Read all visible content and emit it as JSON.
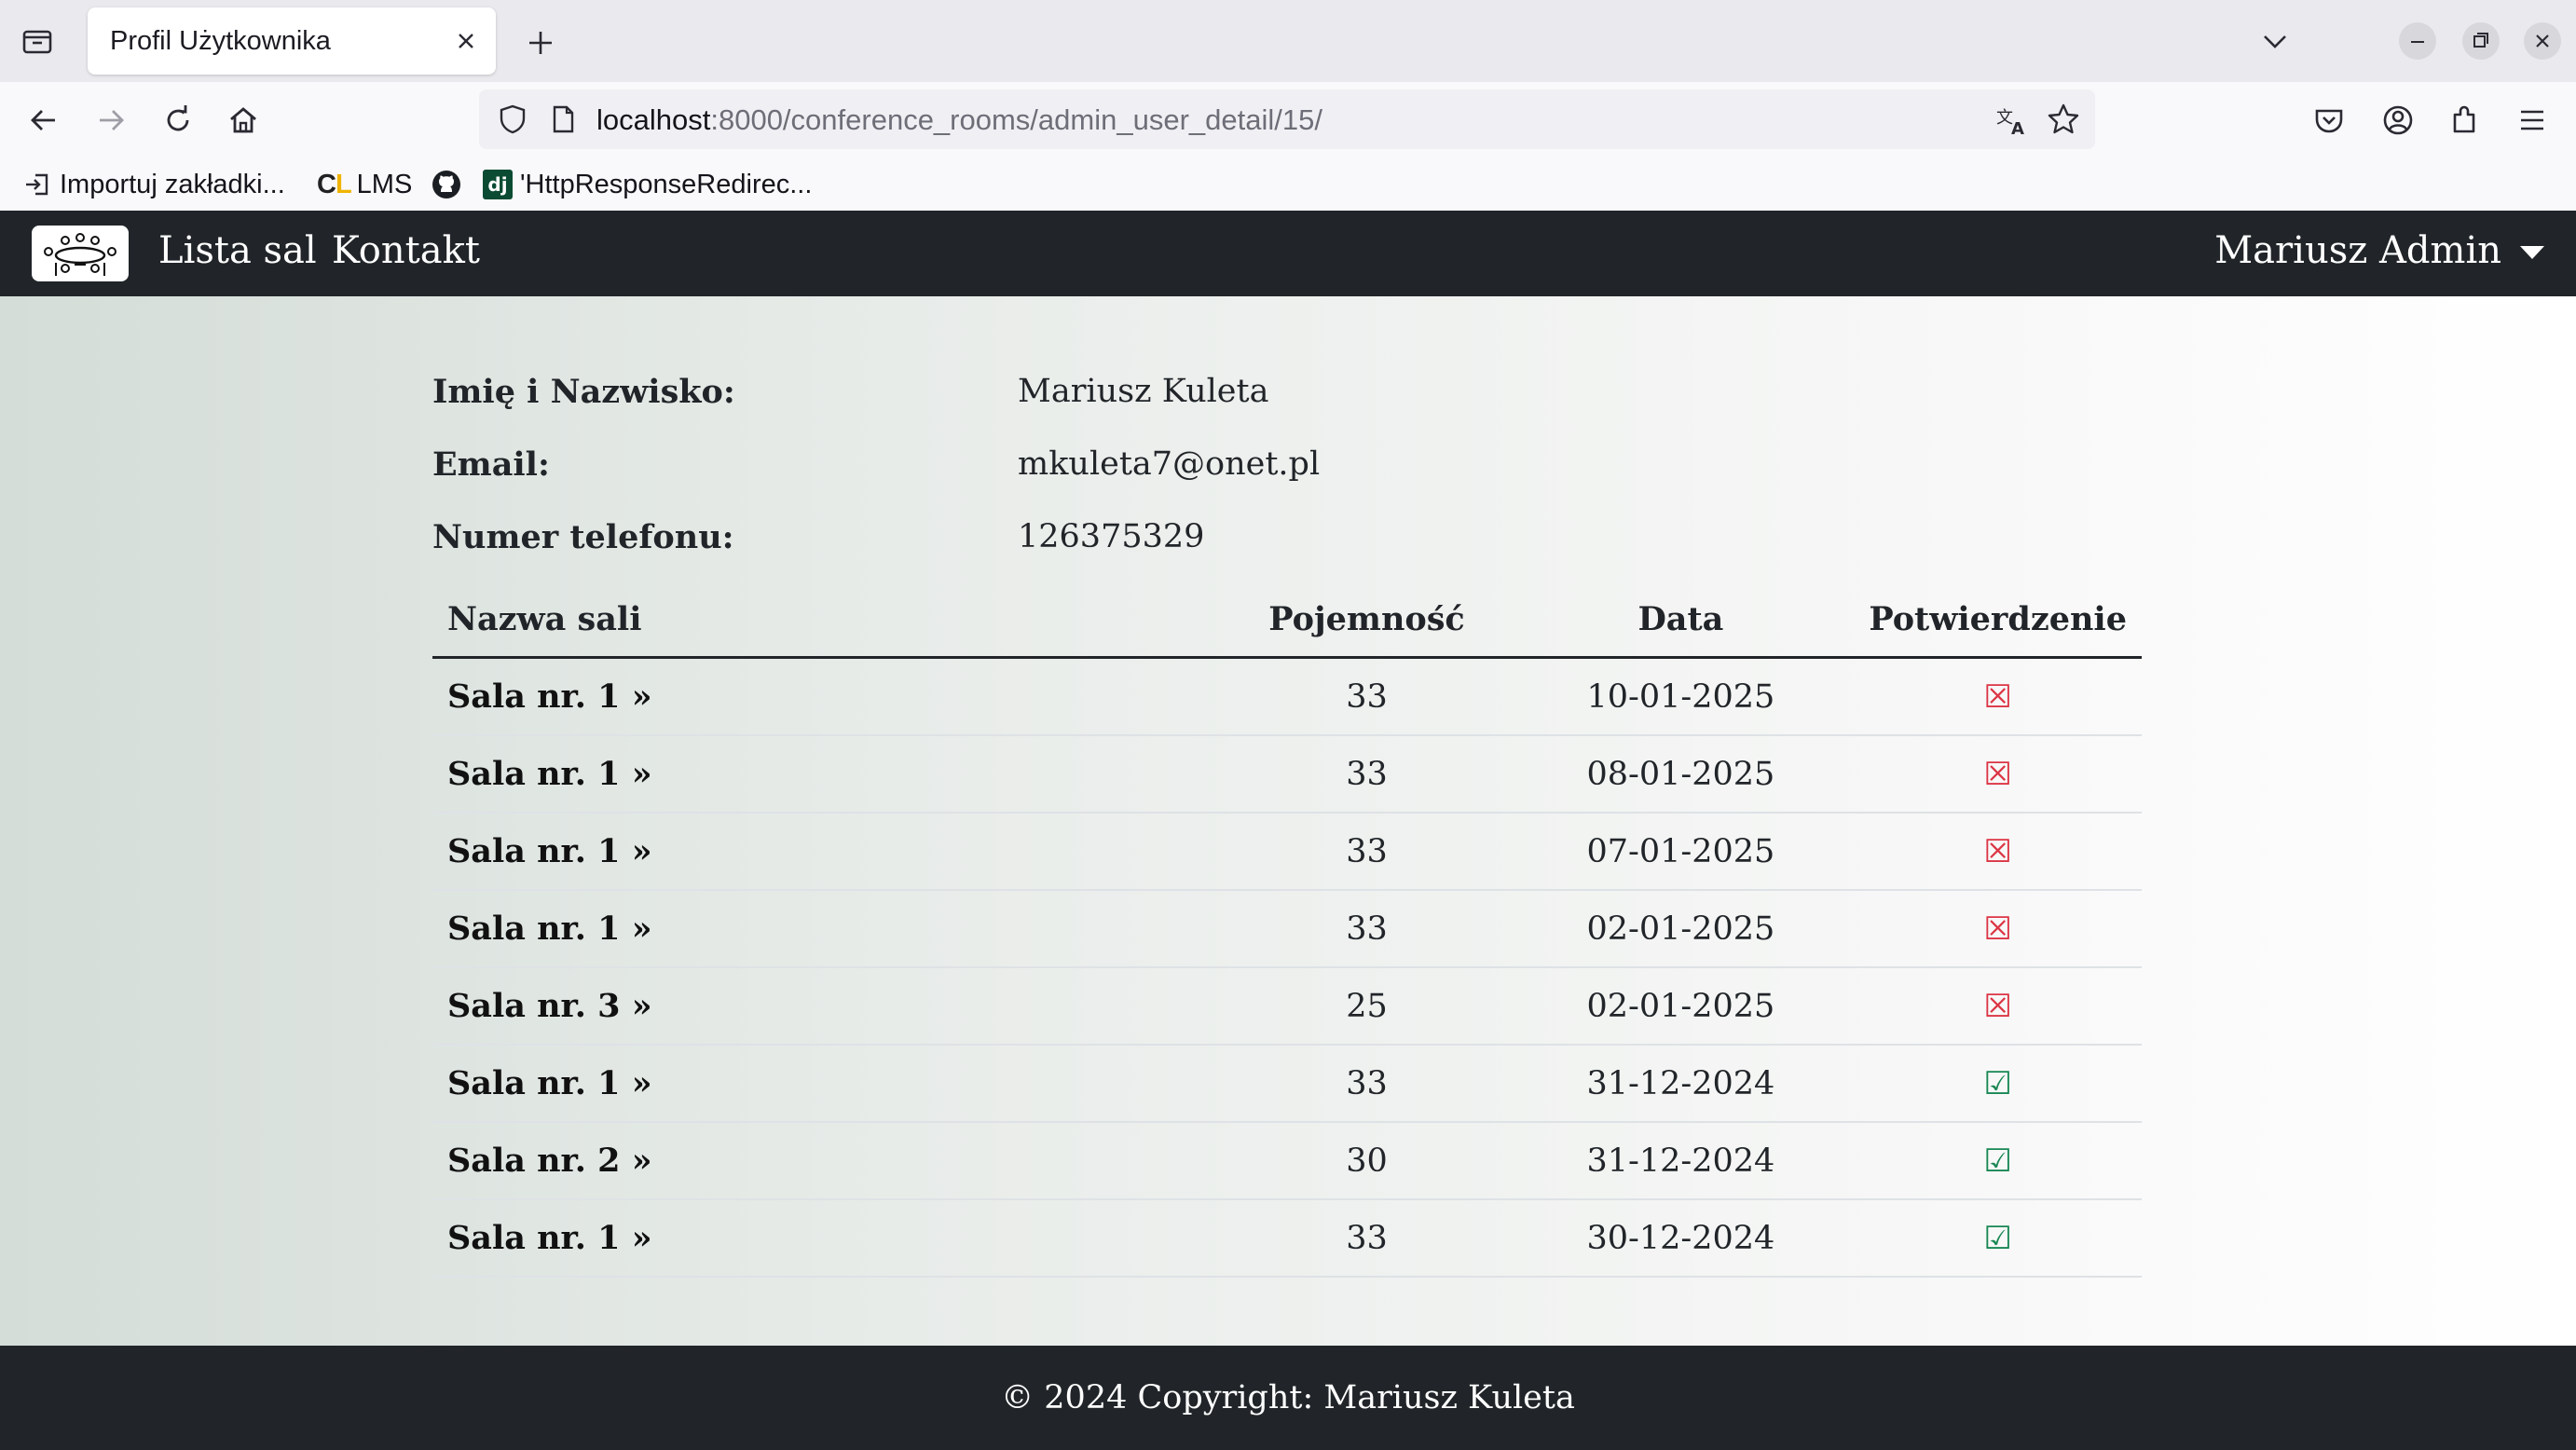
{
  "browser": {
    "tab_title": "Profil Użytkownika",
    "url_host": "localhost",
    "url_rest": ":8000/conference_rooms/admin_user_detail/15/",
    "bookmarks": [
      {
        "label": "Importuj zakładki..."
      },
      {
        "label": "LMS",
        "logo": "CL"
      },
      {
        "label": "",
        "icon": "github-icon"
      },
      {
        "label": "'HttpResponseRedirec...",
        "logo": "dj"
      }
    ]
  },
  "site_nav": {
    "links": [
      "Lista sal",
      "Kontakt"
    ],
    "user": "Mariusz Admin"
  },
  "profile": {
    "name_label": "Imię i Nazwisko:",
    "name_value": "Mariusz Kuleta",
    "email_label": "Email:",
    "email_value": "mkuleta7@onet.pl",
    "phone_label": "Numer telefonu:",
    "phone_value": "126375329"
  },
  "table": {
    "headers": [
      "Nazwa sali",
      "Pojemność",
      "Data",
      "Potwierdzenie"
    ],
    "rows": [
      {
        "room": "Sala nr. 1 »",
        "capacity": "33",
        "date": "10-01-2025",
        "confirmed": false
      },
      {
        "room": "Sala nr. 1 »",
        "capacity": "33",
        "date": "08-01-2025",
        "confirmed": false
      },
      {
        "room": "Sala nr. 1 »",
        "capacity": "33",
        "date": "07-01-2025",
        "confirmed": false
      },
      {
        "room": "Sala nr. 1 »",
        "capacity": "33",
        "date": "02-01-2025",
        "confirmed": false
      },
      {
        "room": "Sala nr. 3 »",
        "capacity": "25",
        "date": "02-01-2025",
        "confirmed": false
      },
      {
        "room": "Sala nr. 1 »",
        "capacity": "33",
        "date": "31-12-2024",
        "confirmed": true
      },
      {
        "room": "Sala nr. 2 »",
        "capacity": "30",
        "date": "31-12-2024",
        "confirmed": true
      },
      {
        "room": "Sala nr. 1 »",
        "capacity": "33",
        "date": "30-12-2024",
        "confirmed": true
      }
    ],
    "mark_confirmed": "☑",
    "mark_unconfirmed": "☒",
    "colors": {
      "confirmed": "#198754",
      "unconfirmed": "#dc3545"
    }
  },
  "footer": {
    "text": "© 2024 Copyright: Mariusz Kuleta"
  }
}
